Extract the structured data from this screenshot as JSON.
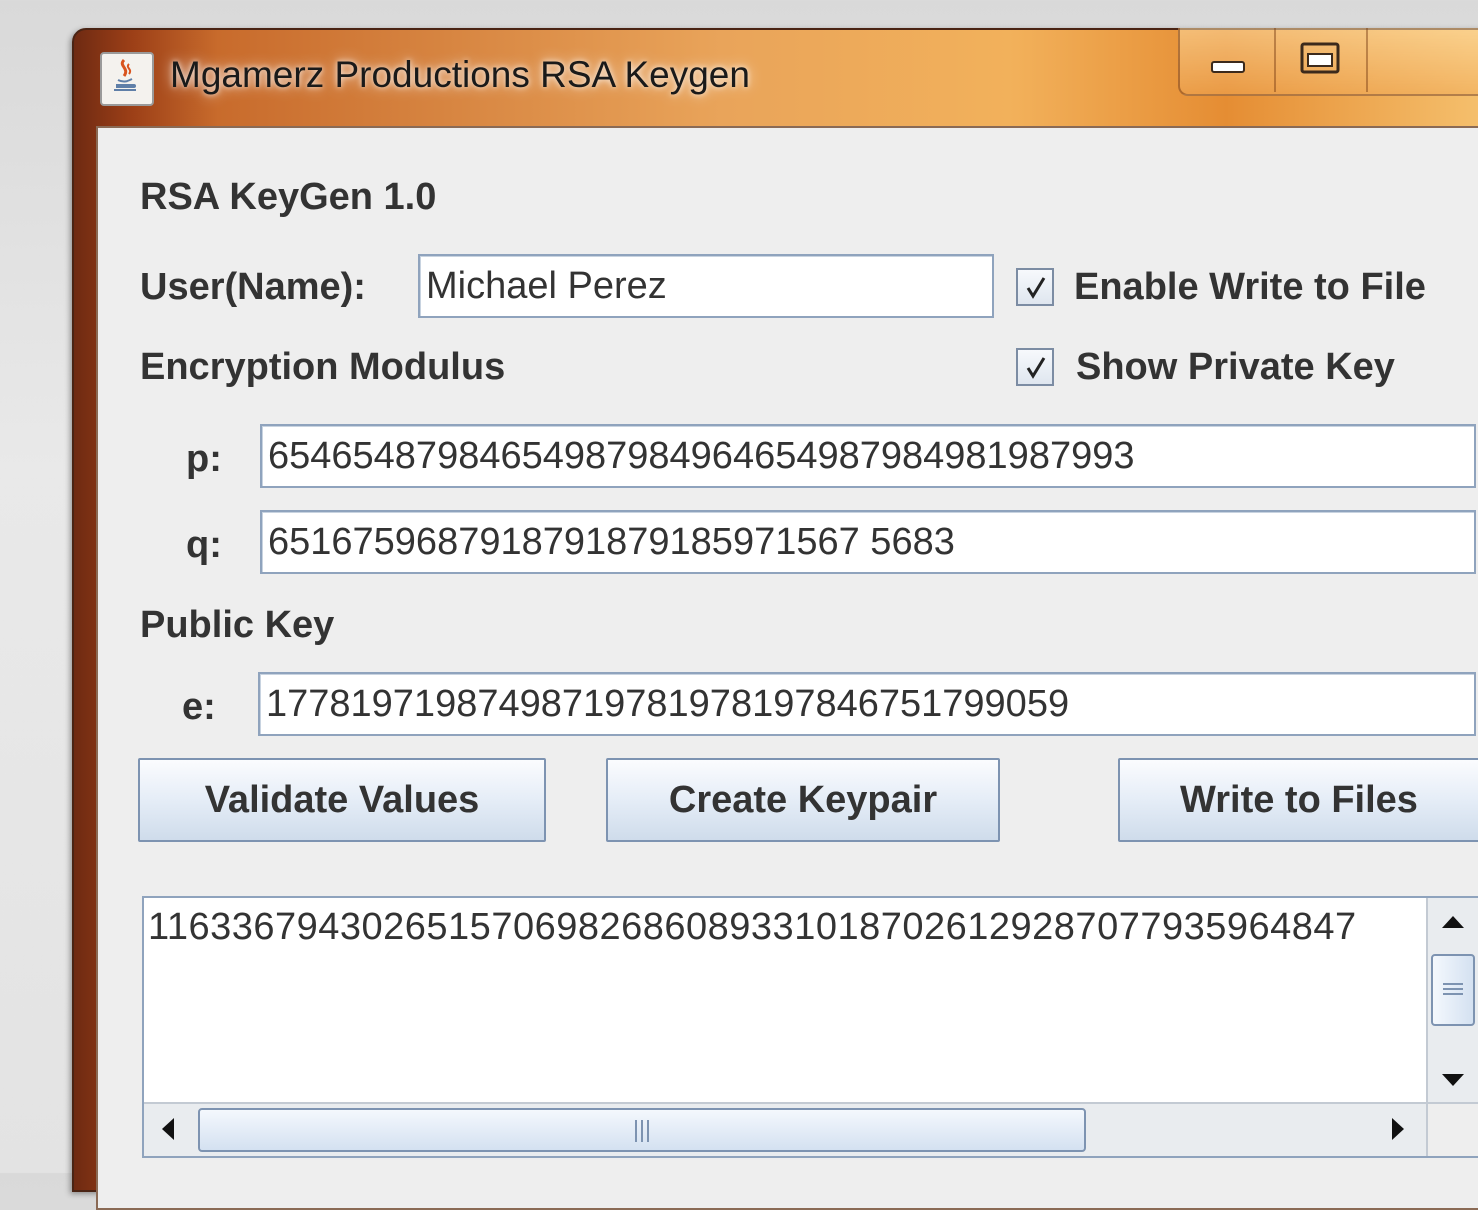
{
  "window": {
    "title": "Mgamerz Productions RSA Keygen",
    "icon": "java-cup-icon",
    "controls": {
      "minimize": "minimize-icon",
      "maximize": "maximize-icon",
      "close": "close-icon"
    }
  },
  "header": {
    "app_name": "RSA KeyGen 1.0"
  },
  "user": {
    "label": "User(Name):",
    "value": "Michael Perez"
  },
  "options": {
    "enable_write": {
      "label": "Enable Write to File",
      "checked": true
    },
    "show_private": {
      "label": "Show Private Key",
      "checked": true
    }
  },
  "modulus": {
    "heading": "Encryption Modulus",
    "p_label": "p:",
    "p_value": "65465487984654987984964654987984981987993",
    "q_label": "q:",
    "q_value": "6516759687918791879185971567 5683"
  },
  "public_key": {
    "heading": "Public Key",
    "e_label": "e:",
    "e_value": "17781971987498719781978197846751799059"
  },
  "buttons": {
    "validate": "Validate Values",
    "create": "Create Keypair",
    "write": "Write to Files"
  },
  "output": {
    "text": "11633679430265157069826860893310187026129287077935964847"
  },
  "colors": {
    "title_bar_accent": "#e9a45a",
    "panel_bg": "#eeeeee",
    "field_border": "#8fa3bd"
  }
}
